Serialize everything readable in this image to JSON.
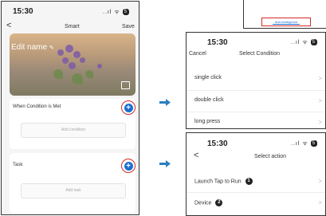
{
  "left_screen": {
    "time": "15:30",
    "signal": "..ıl",
    "wifi": "ᯤ",
    "battery": "5",
    "back": "<",
    "title": "Smart",
    "save": "Save",
    "edit_name": "Edit name",
    "edit_icon": "pencil-icon",
    "condition_label": "When Condition is Met",
    "add_condition": "Add condition",
    "task_label": "Task",
    "add_task": "Add task",
    "plus": "+"
  },
  "snippet": {
    "button_label": "Add Intelligence"
  },
  "condition_screen": {
    "time": "15:30",
    "signal": "..ıl",
    "wifi": "ᯤ",
    "battery": "5",
    "cancel": "Cancel",
    "title": "Select Condition",
    "items": [
      {
        "label": "single click"
      },
      {
        "label": "double click"
      },
      {
        "label": "long press"
      }
    ],
    "chevron": ">"
  },
  "action_screen": {
    "time": "15:30",
    "signal": "..ıl",
    "wifi": "ᯤ",
    "battery": "5",
    "back": "<",
    "title": "Select action",
    "items": [
      {
        "label": "Launch Tap to Run",
        "badge": "1"
      },
      {
        "label": "Device",
        "badge": "2"
      }
    ],
    "chevron": ">"
  },
  "colors": {
    "accent": "#1a6fd1",
    "highlight": "#d42a2a",
    "arrow": "#2a7fbf"
  }
}
